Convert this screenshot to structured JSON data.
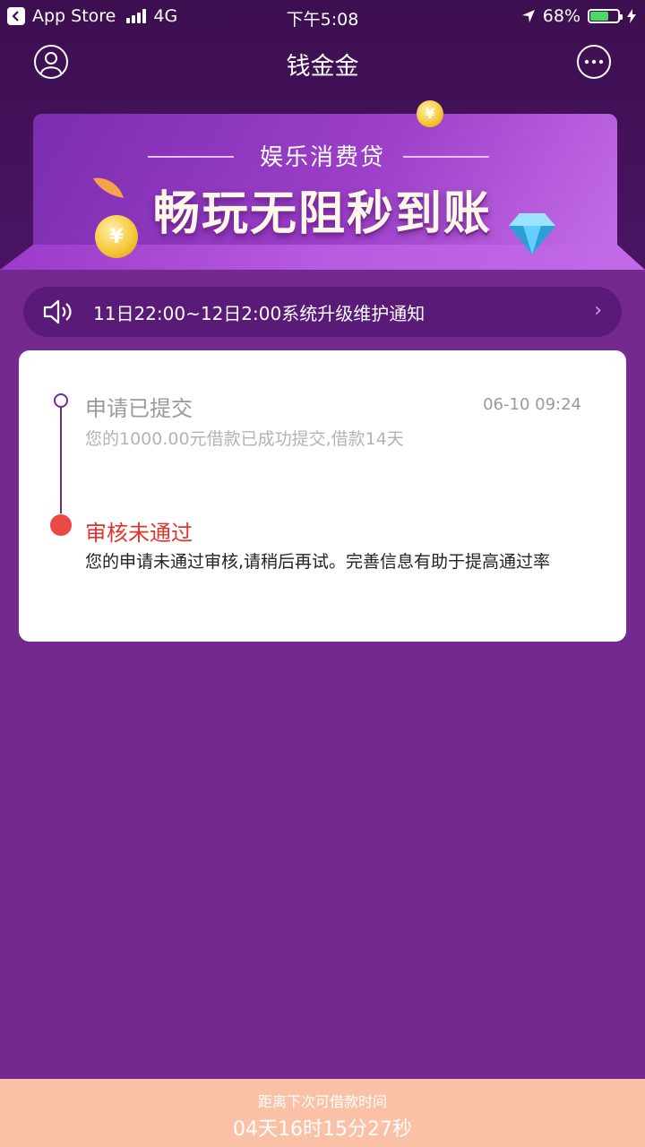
{
  "status_bar": {
    "back_app": "App Store",
    "network": "4G",
    "time": "下午5:08",
    "battery_percent": "68%",
    "battery_level": 0.68
  },
  "nav": {
    "title": "钱金金",
    "left_icon": "user-icon",
    "right_icon": "message-icon"
  },
  "banner": {
    "subtitle": "娱乐消费贷",
    "headline": "畅玩无阻秒到账"
  },
  "notice": {
    "icon": "speaker-icon",
    "text": "11日22:00~12日2:00系统升级维护通知",
    "arrow": "›"
  },
  "timeline": [
    {
      "title": "申请已提交",
      "time": "06-10 09:24",
      "desc": "您的1000.00元借款已成功提交,借款14天"
    },
    {
      "title": "审核未通过",
      "desc": "您的申请未通过审核,请稍后再试。完善信息有助于提高通过率"
    }
  ],
  "footer": {
    "label": "距离下次可借款时间",
    "countdown": "04天16时15分27秒"
  },
  "colors": {
    "background": "#74298f",
    "accent_red": "#e94a43",
    "footer": "#fbc1a6"
  }
}
